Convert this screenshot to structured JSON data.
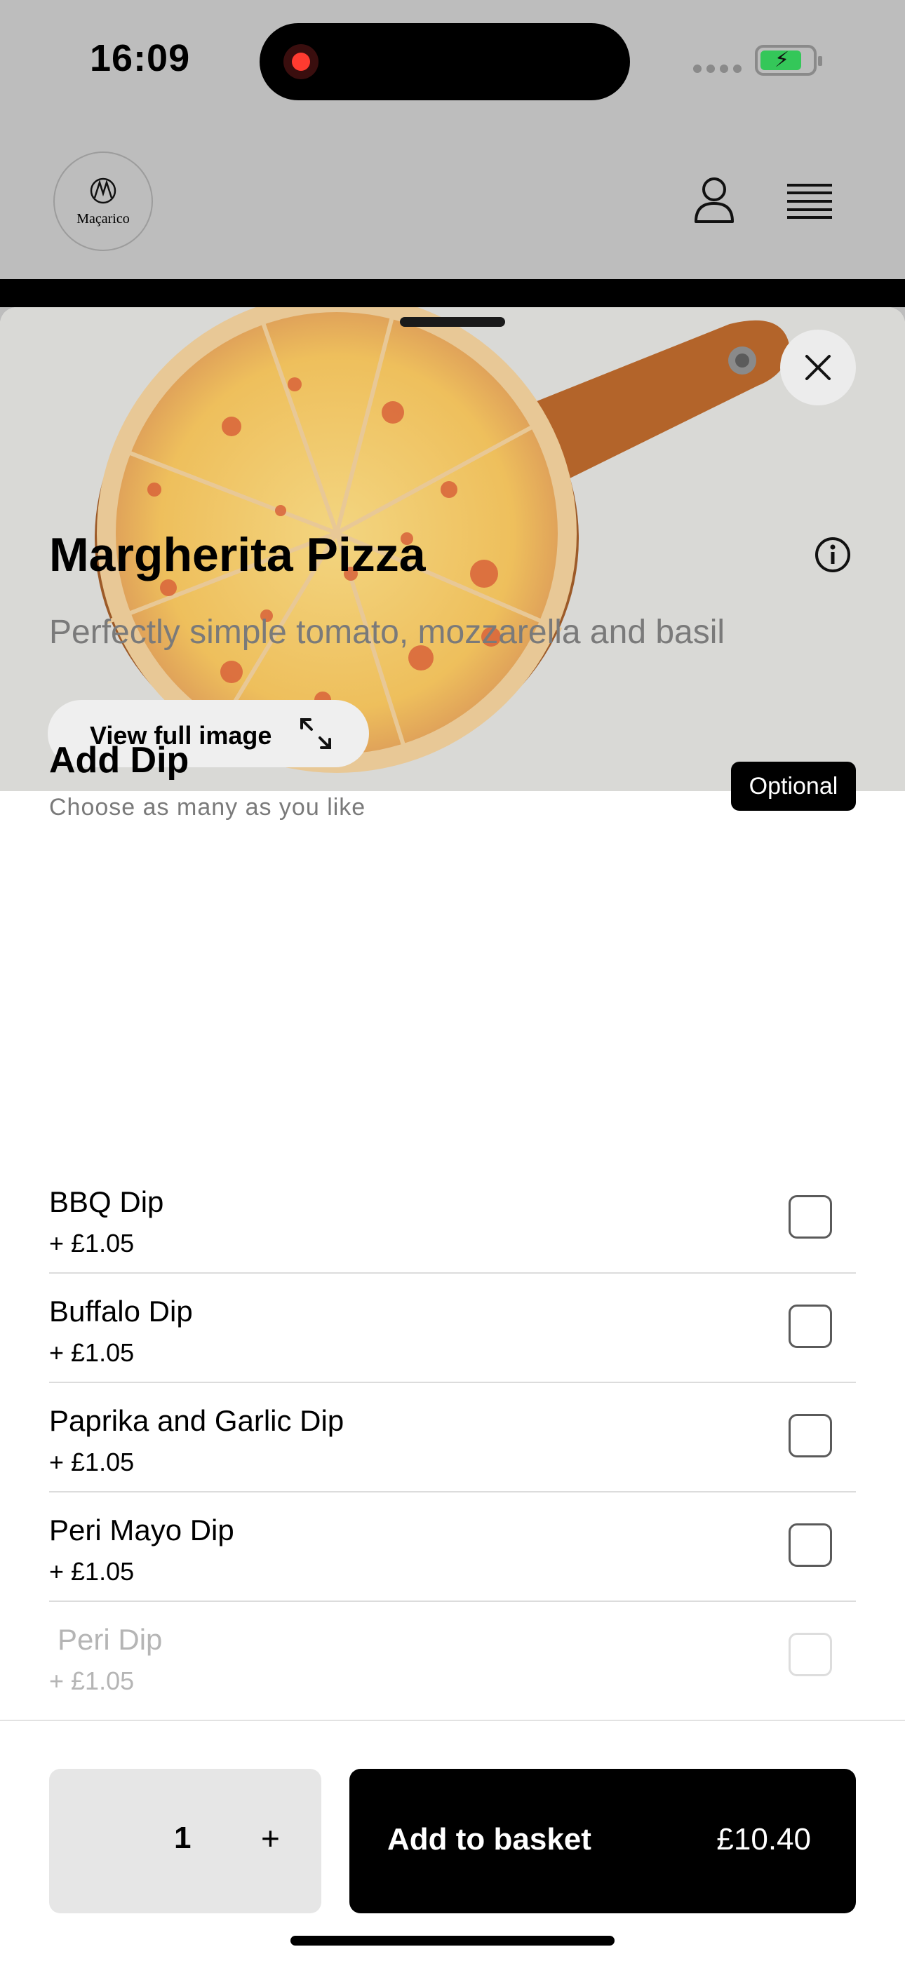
{
  "status_bar": {
    "time": "16:09"
  },
  "header": {
    "brand": "Maçarico"
  },
  "product": {
    "title": "Margherita Pizza",
    "description": "Perfectly simple tomato, mozzarella and basil",
    "view_full_image": "View full image"
  },
  "dips": {
    "title": "Add Dip",
    "subtitle": "Choose as many as you like",
    "badge": "Optional",
    "options": [
      {
        "name": "BBQ Dip",
        "price": "+ £1.05"
      },
      {
        "name": "Buffalo Dip",
        "price": "+ £1.05"
      },
      {
        "name": "Paprika and Garlic Dip",
        "price": "+ £1.05"
      },
      {
        "name": "Peri Mayo Dip",
        "price": "+ £1.05"
      },
      {
        "name": "Peri Dip",
        "price": "+ £1.05"
      }
    ]
  },
  "footer": {
    "quantity": "1",
    "plus": "+",
    "add_label": "Add to basket",
    "total": "£10.40"
  },
  "colors": {
    "accent": "#000000",
    "battery": "#34c759",
    "record": "#ff3b30"
  },
  "icons": [
    "record-icon",
    "battery-icon",
    "user-icon",
    "menu-icon",
    "close-icon",
    "expand-icon",
    "info-icon"
  ]
}
